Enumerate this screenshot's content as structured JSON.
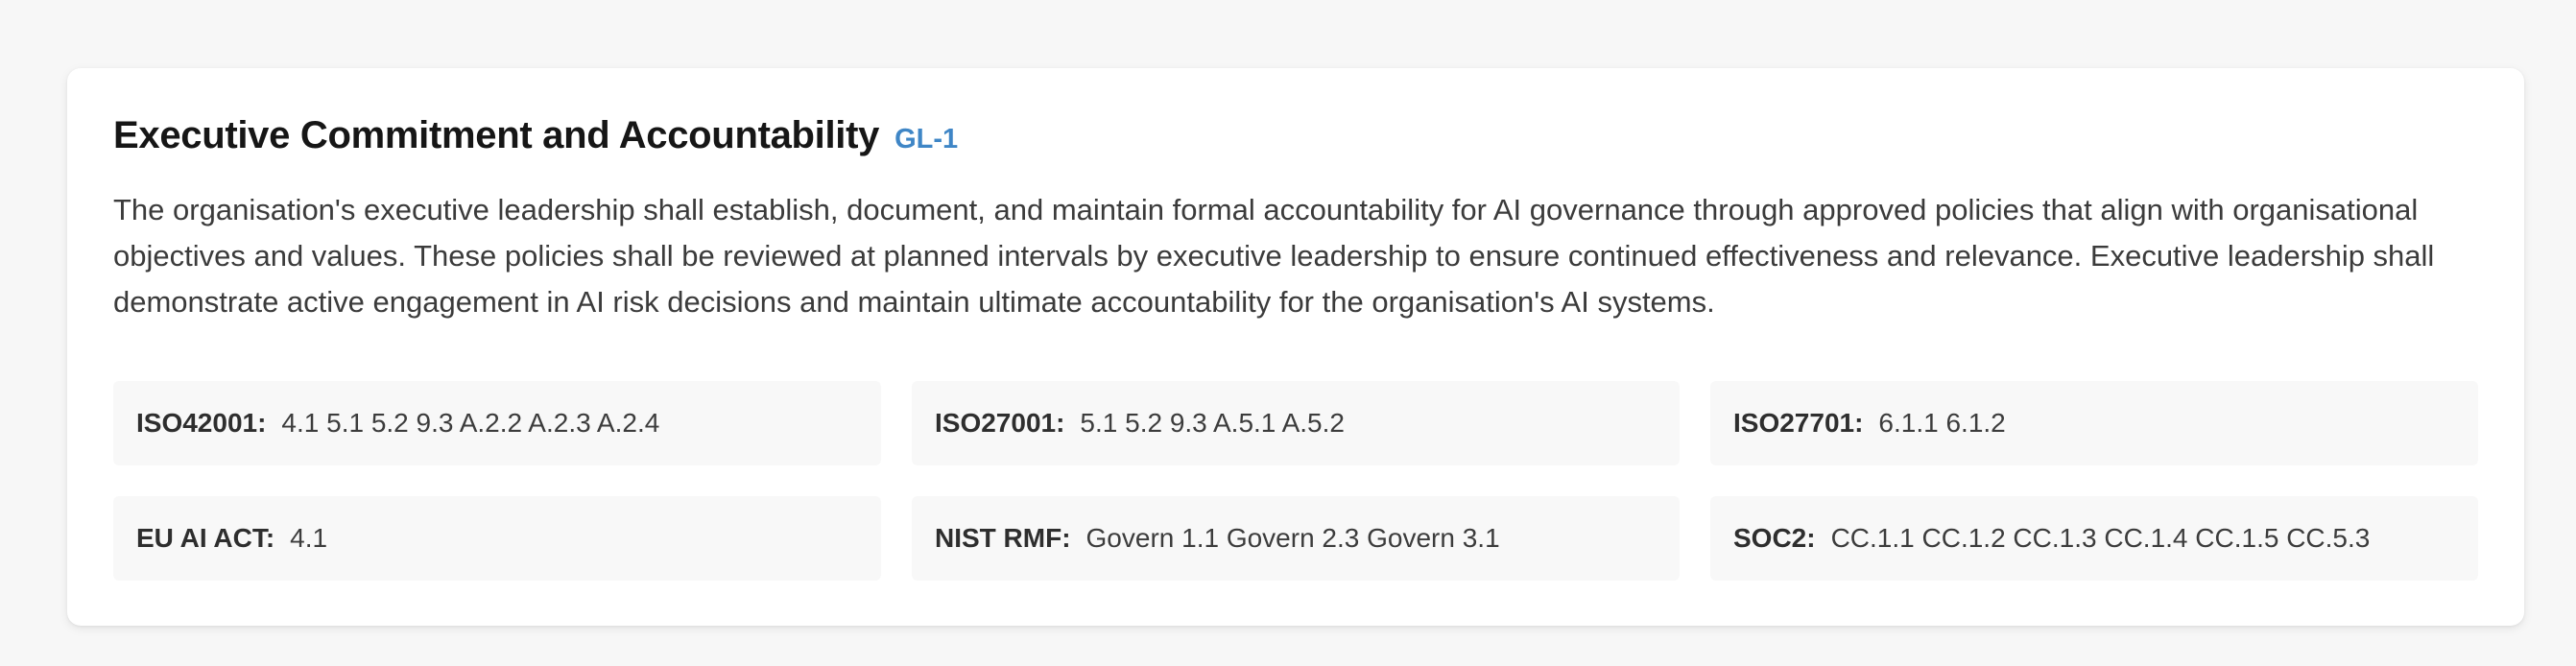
{
  "control": {
    "title": "Executive Commitment and Accountability",
    "code": "GL-1",
    "description": "The organisation's executive leadership shall establish, document, and maintain formal accountability for AI governance through approved policies that align with organisational objectives and values. These policies shall be reviewed at planned intervals by executive leadership to ensure continued effectiveness and relevance. Executive leadership shall demonstrate active engagement in AI risk decisions and maintain ultimate accountability for the organisation's AI systems."
  },
  "mappings": [
    {
      "label": "ISO42001:",
      "value": "4.1 5.1 5.2 9.3 A.2.2 A.2.3 A.2.4"
    },
    {
      "label": "ISO27001:",
      "value": "5.1 5.2 9.3 A.5.1 A.5.2"
    },
    {
      "label": "ISO27701:",
      "value": "6.1.1 6.1.2"
    },
    {
      "label": "EU AI ACT:",
      "value": "4.1"
    },
    {
      "label": "NIST RMF:",
      "value": "Govern 1.1 Govern 2.3 Govern 3.1"
    },
    {
      "label": "SOC2:",
      "value": "CC.1.1 CC.1.2 CC.1.3 CC.1.4 CC.1.5 CC.5.3"
    }
  ],
  "colors": {
    "accent": "#3f86c6",
    "card_background": "#ffffff",
    "page_background": "#f7f7f7",
    "chip_background": "#f8f8f8"
  }
}
